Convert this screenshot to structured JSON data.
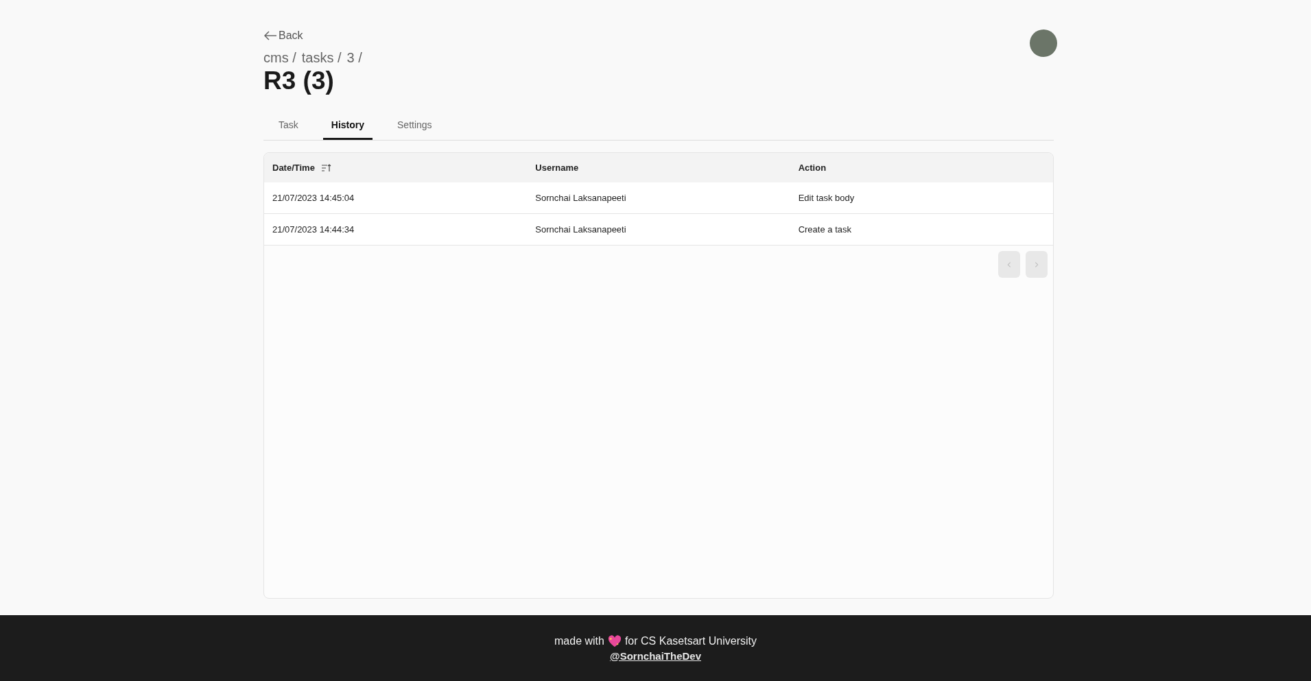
{
  "back": {
    "label": "Back"
  },
  "breadcrumb": [
    "cms /",
    "tasks /",
    "3 /"
  ],
  "title": "R3 (3)",
  "tabs": [
    {
      "label": "Task",
      "selected": false
    },
    {
      "label": "History",
      "selected": true
    },
    {
      "label": "Settings",
      "selected": false
    }
  ],
  "table": {
    "columns": [
      {
        "label": "Date/Time",
        "sorted": true
      },
      {
        "label": "Username",
        "sorted": false
      },
      {
        "label": "Action",
        "sorted": false
      }
    ],
    "rows": [
      [
        "21/07/2023 14:45:04",
        "Sornchai Laksanapeeti",
        "Edit task body"
      ],
      [
        "21/07/2023 14:44:34",
        "Sornchai Laksanapeeti",
        "Create a task"
      ]
    ]
  },
  "pagination": {
    "prev_disabled": true,
    "next_disabled": true
  },
  "footer": {
    "before": "made with",
    "after": "for CS Kasetsart University",
    "link": "@SornchaiTheDev"
  }
}
